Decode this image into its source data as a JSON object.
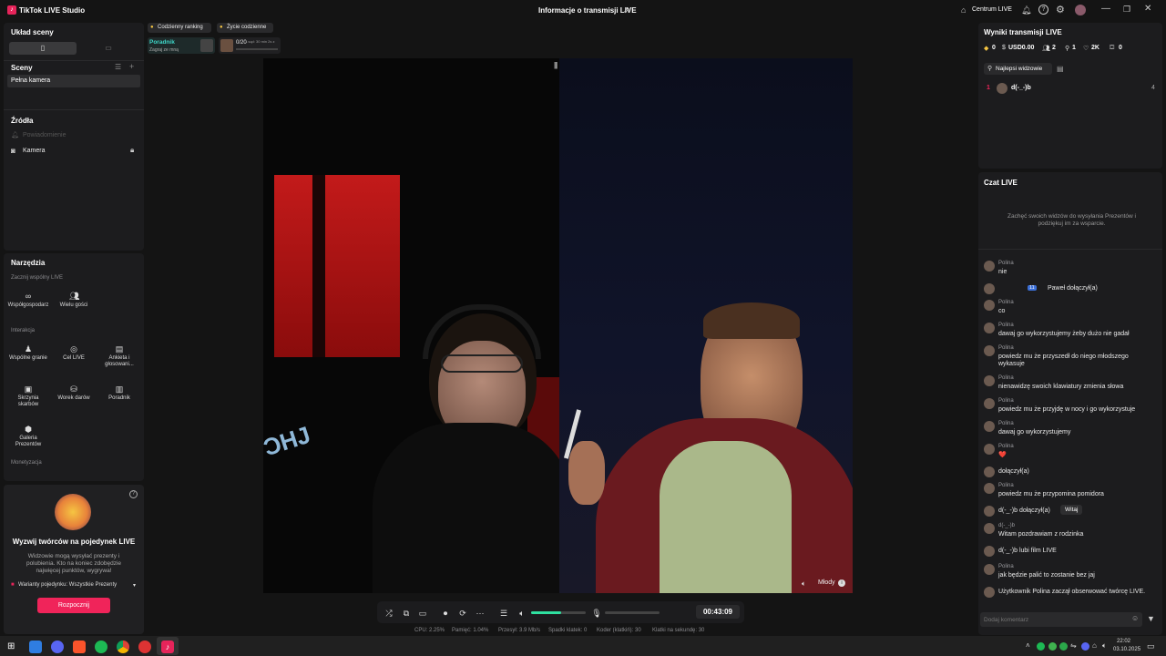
{
  "app": {
    "title": "TikTok LIVE Studio"
  },
  "window": {
    "center_title": "Informacje o transmisji LIVE",
    "centrum_label": "Centrum LIVE"
  },
  "left": {
    "scene_layout_title": "Układ sceny",
    "scenes_title": "Sceny",
    "scene_item": "Pełna kamera",
    "sources_title": "Źródła",
    "source_notifications": "Powiadomienie",
    "source_camera": "Kamera",
    "tools_title": "Narzędzia",
    "shared_live": "Zacznij wspólny LIVE",
    "cohost": "Współgospodarz",
    "multi_guests": "Wielu gości",
    "interaction": "Interakcja",
    "play_together": "Wspólne granie",
    "live_goal": "Cel LIVE",
    "poll": "Ankieta i głosowani...",
    "treasure": "Skrzynia skarbów",
    "gift_bag": "Worek darów",
    "guide": "Poradnik",
    "gift_gallery": "Galeria Prezentów",
    "monetization": "Monetyzacja",
    "promo_title": "Wyzwij twórców na pojedynek LIVE",
    "promo_desc": "Widzowie mogą wysyłać prezenty i polubienia. Kto na koniec zdobędzie najwięcej punktów, wygrywa!",
    "duel_variants": "Warianty pojedynku: Wszystkie Prezenty",
    "start_button": "Rozpocznij"
  },
  "topwidgets": {
    "daily_ranking": "Codzienny ranking",
    "daily_life": "Życie codzienne",
    "guide_title": "Poradnik",
    "guide_sub": "Zagraj ze mną",
    "progress": "0/20",
    "progress_fraction": 0.0,
    "progress_note": "...sąd: 30 min 2s z"
  },
  "stream": {
    "guest_name": "Młody",
    "timer": "00:43:09",
    "volume_fraction": 0.55
  },
  "stats": {
    "cpu": "CPU: 2.25%",
    "memory": "Pamięć: 1.04%",
    "bitrate": "Przesył: 3.9 Mb/s",
    "dropped": "Spadki klatek: 0",
    "encoder": "Koder (klatkiń): 30",
    "fps": "Klatki na sekundę: 30"
  },
  "right": {
    "results_title": "Wyniki transmisji LIVE",
    "stat_diamonds": "0",
    "stat_usd": "USD0.00",
    "stat_viewers": "2",
    "stat_new": "1",
    "stat_likes": "2K",
    "stat_gifts": "0",
    "top_viewers_tab": "Najlepsi widzowie",
    "top_rank": "1",
    "top_name": "d(-_-)b",
    "top_score": "4",
    "chat_title": "Czat LIVE",
    "chat_hint": "Zachęć swoich widzów do wysyłania Prezentów i podziękuj im za wsparcie.",
    "comment_placeholder": "Dodaj komentarz",
    "messages": [
      {
        "name": "Polina",
        "text": "nie"
      },
      {
        "name": "",
        "text": "Paweł dołączył(a)",
        "badge": "11"
      },
      {
        "name": "Polina",
        "text": "co"
      },
      {
        "name": "Polina",
        "text": "dawaj go wykorzystujemy żeby dużo nie gadał"
      },
      {
        "name": "Polina",
        "text": "powiedz mu że przyszedł do niego młodszego wykasuje"
      },
      {
        "name": "Polina",
        "text": "nienawidzę swoich klawiatury zmienia słowa"
      },
      {
        "name": "Polina",
        "text": "powiedz mu że przyjdę w nocy i go wykorzystuje"
      },
      {
        "name": "Polina",
        "text": "dawaj go wykorzystujemy"
      },
      {
        "name": "Polina",
        "text": "❤️"
      },
      {
        "name": "",
        "text": "dołączył(a)"
      },
      {
        "name": "Polina",
        "text": "powiedz mu że przypomina pomidora"
      },
      {
        "name": "",
        "text": "d(-_-)b dołączył(a)",
        "action": "Witaj"
      },
      {
        "name": "d(-_-)b",
        "text": "Witam pozdrawiam z rodzinka"
      },
      {
        "name": "",
        "text": "d(-_-)b lubi film LIVE"
      },
      {
        "name": "Polina",
        "text": "jak będzie palić to zostanie bez jaj"
      },
      {
        "name": "",
        "text": "Użytkownik Polina zaczął obserwować twórcę LIVE."
      }
    ]
  },
  "taskbar": {
    "time": "22:02",
    "date": "03.10.2025"
  }
}
